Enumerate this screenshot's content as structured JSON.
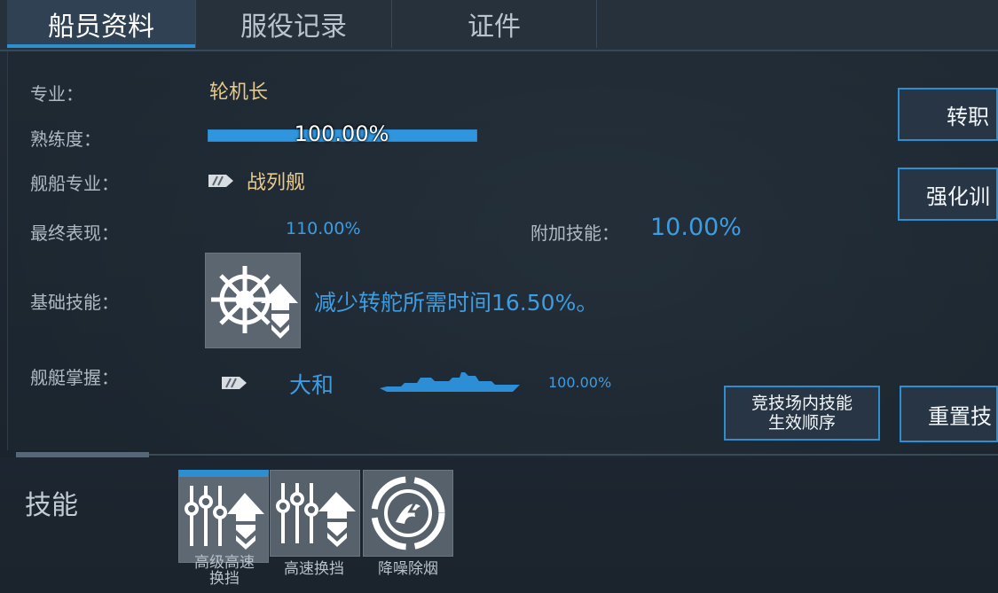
{
  "tabs": [
    {
      "label": "船员资料",
      "active": true
    },
    {
      "label": "服役记录",
      "active": false
    },
    {
      "label": "证件",
      "active": false
    }
  ],
  "profile": {
    "specialty_label": "专业：",
    "specialty_value": "轮机长",
    "proficiency_label": "熟练度：",
    "proficiency_value": "100.00%",
    "proficiency_fraction": 1.0,
    "ship_specialty_label": "舰船专业：",
    "ship_specialty_value": "战列舰",
    "final_perf_label": "最终表现：",
    "final_perf_value": "110.00%",
    "extra_skill_label": "附加技能：",
    "extra_skill_value": "10.00%",
    "base_skill_label": "基础技能：",
    "base_skill_desc": "减少转舵所需时间16.50%。",
    "ship_mastery_label": "舰艇掌握：",
    "ship_mastery_name": "大和",
    "ship_mastery_value": "100.00%"
  },
  "buttons": {
    "change_job": "转职",
    "enhance_training": "强化训",
    "arena_order_line1": "竞技场内技能",
    "arena_order_line2": "生效顺序",
    "reset": "重置技"
  },
  "skills_section": {
    "title": "技能",
    "items": [
      {
        "name_line1": "高级高速",
        "name_line2": "换挡",
        "icon": "gear-shift-upgrade-icon",
        "selected": true
      },
      {
        "name_line1": "高速换挡",
        "name_line2": "",
        "icon": "gear-shift-icon",
        "selected": false
      },
      {
        "name_line1": "降噪除烟",
        "name_line2": "",
        "icon": "noise-smoke-reduction-icon",
        "selected": false
      }
    ]
  },
  "colors": {
    "accent_blue": "#2e8fd0",
    "gold_text": "#e8c98a",
    "blue_text": "#3e9ce0"
  }
}
